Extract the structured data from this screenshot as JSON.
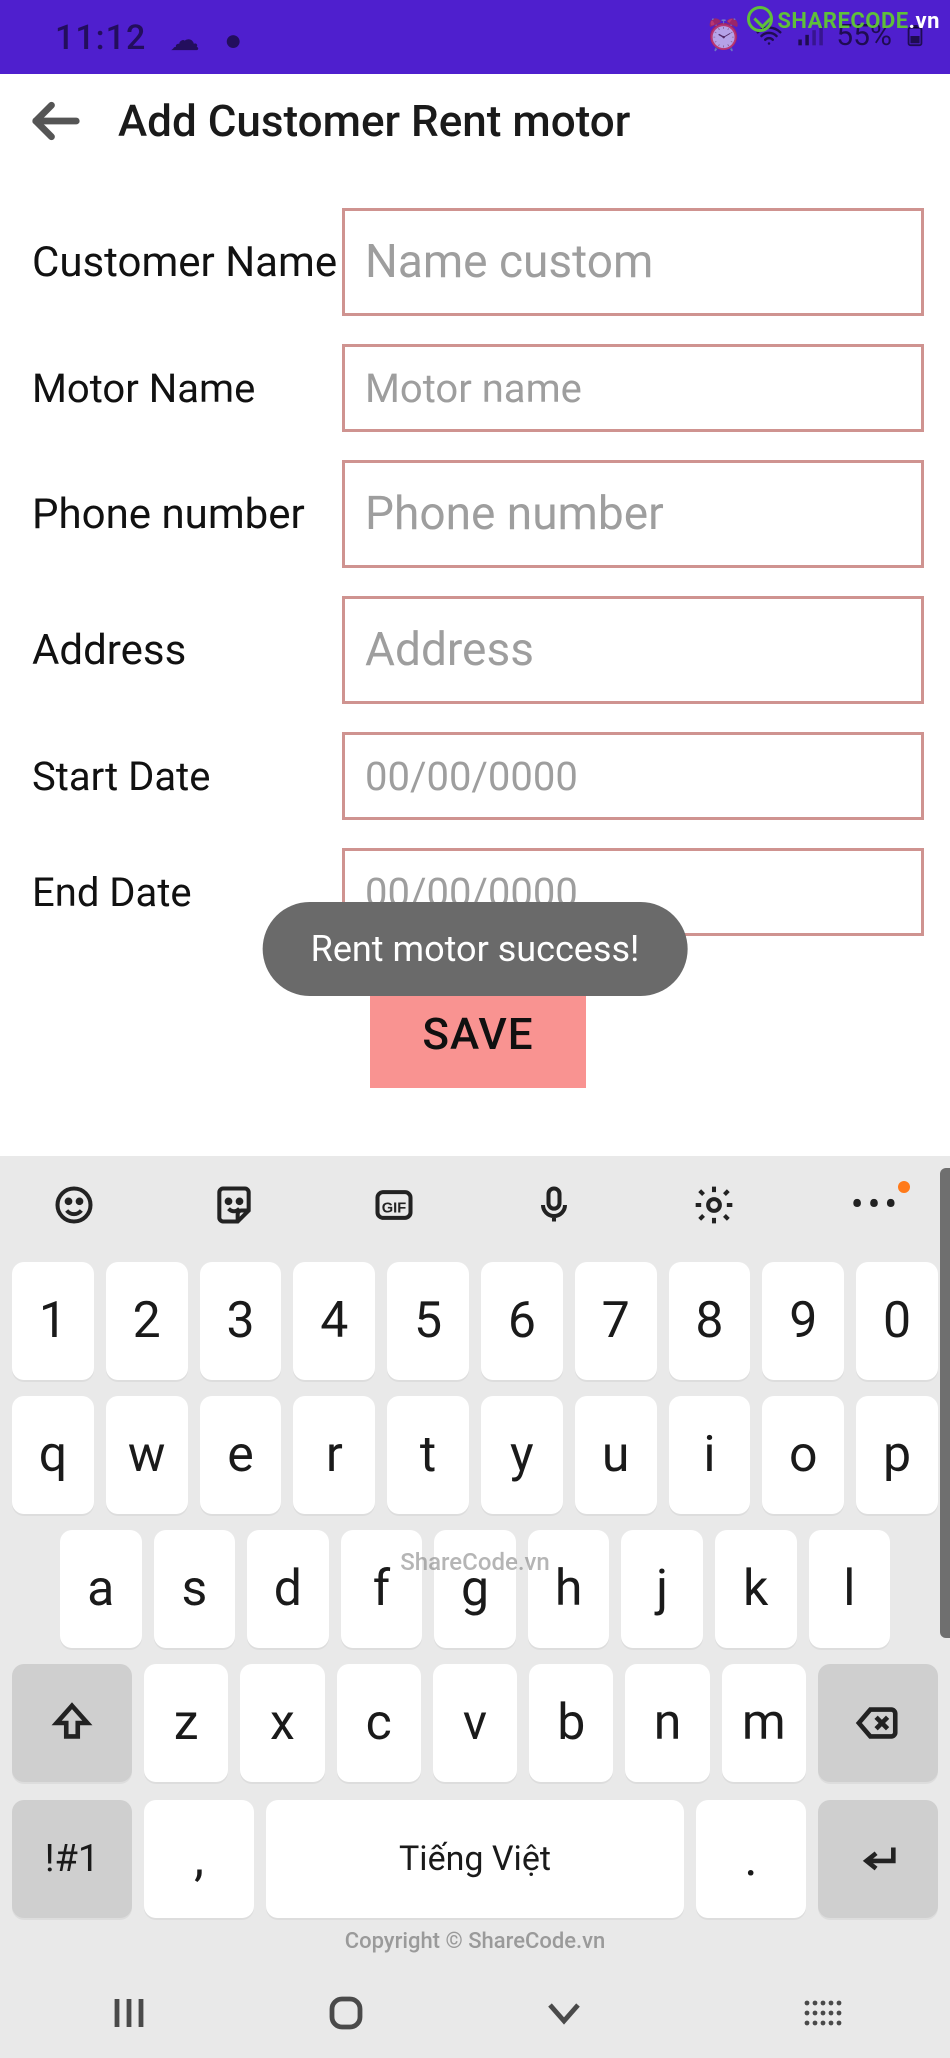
{
  "status": {
    "time": "11:12",
    "battery": "55%"
  },
  "watermark": {
    "brand": "SHARECODE",
    "tld": ".vn",
    "center": "ShareCode.vn",
    "copyright": "Copyright © ShareCode.vn"
  },
  "header": {
    "title": "Add Customer Rent motor"
  },
  "form": {
    "customer_name": {
      "label": "Customer Name",
      "placeholder": "Name custom"
    },
    "motor_name": {
      "label": "Motor Name",
      "placeholder": "Motor name"
    },
    "phone": {
      "label": "Phone number",
      "placeholder": "Phone number"
    },
    "address": {
      "label": "Address",
      "placeholder": "Address"
    },
    "start_date": {
      "label": "Start Date",
      "placeholder": "00/00/0000"
    },
    "end_date": {
      "label": "End Date",
      "placeholder": "00/00/0000"
    },
    "save": "SAVE"
  },
  "toast": "Rent motor success!",
  "keyboard": {
    "row1": [
      "1",
      "2",
      "3",
      "4",
      "5",
      "6",
      "7",
      "8",
      "9",
      "0"
    ],
    "row2": [
      "q",
      "w",
      "e",
      "r",
      "t",
      "y",
      "u",
      "i",
      "o",
      "p"
    ],
    "row3": [
      "a",
      "s",
      "d",
      "f",
      "g",
      "h",
      "j",
      "k",
      "l"
    ],
    "row4": [
      "z",
      "x",
      "c",
      "v",
      "b",
      "n",
      "m"
    ],
    "sym": "!#1",
    "comma": ",",
    "space": "Tiếng Việt",
    "dot": "."
  }
}
